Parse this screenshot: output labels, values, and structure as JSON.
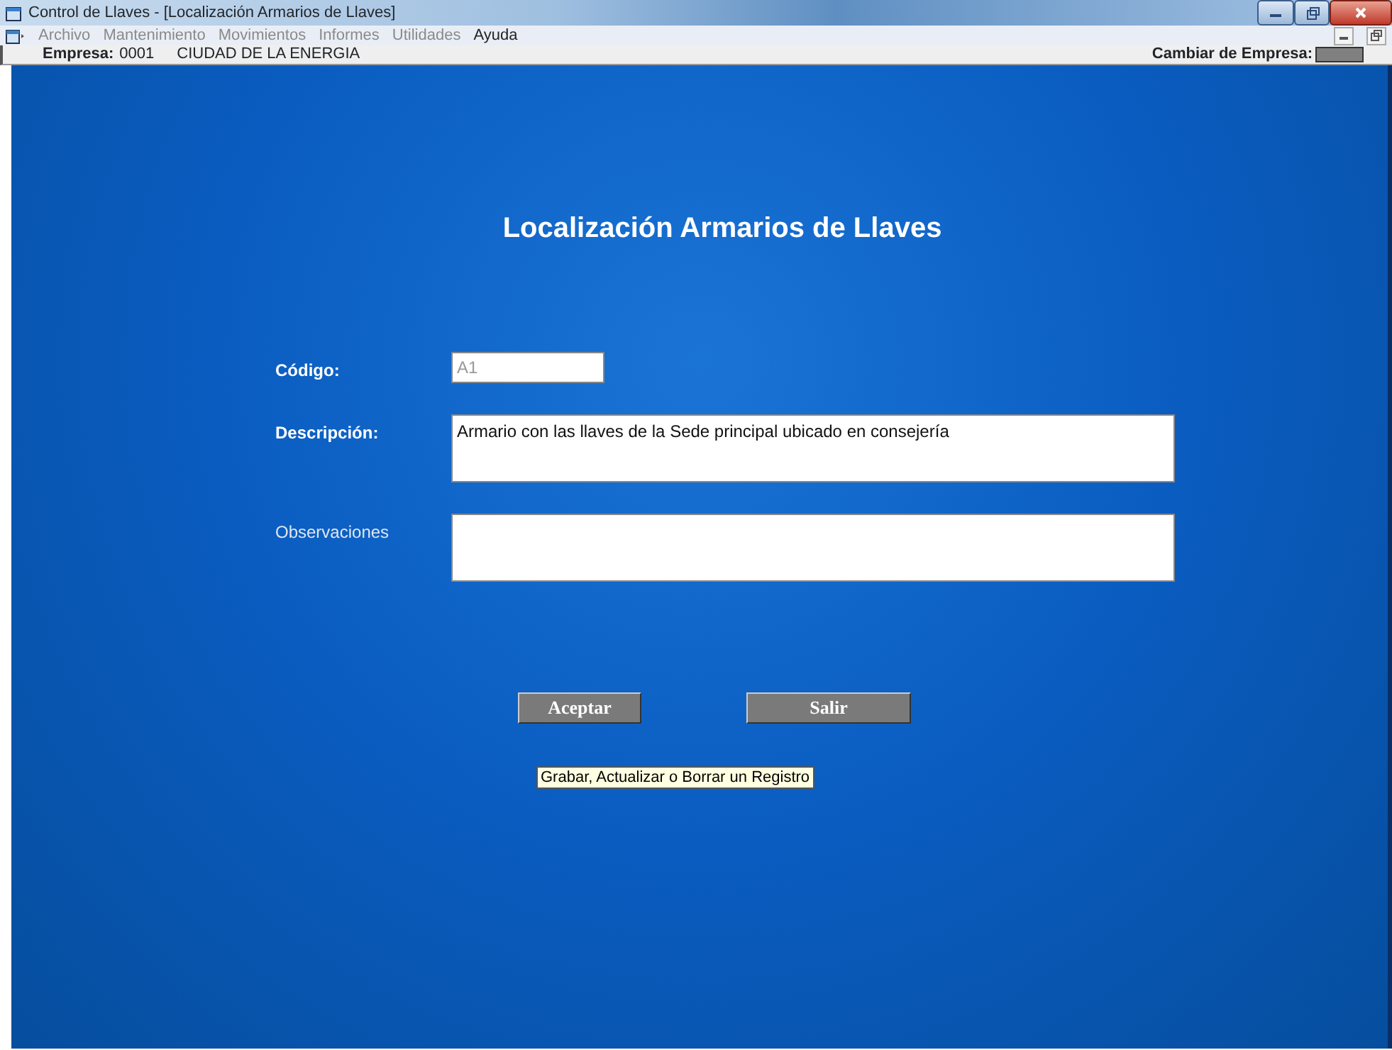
{
  "window": {
    "title": "Control de Llaves - [Localización Armarios de Llaves]"
  },
  "menu": [
    {
      "label": "Archivo",
      "disabled": true
    },
    {
      "label": "Mantenimiento",
      "disabled": true
    },
    {
      "label": "Movimientos",
      "disabled": true
    },
    {
      "label": "Informes",
      "disabled": true
    },
    {
      "label": "Utilidades",
      "disabled": true
    },
    {
      "label": "Ayuda",
      "disabled": false
    }
  ],
  "company_bar": {
    "label": "Empresa:",
    "code": "0001",
    "name": "CIUDAD DE LA ENERGIA",
    "change_label": "Cambiar de Empresa:"
  },
  "form": {
    "title": "Localización Armarios de Llaves",
    "fields": [
      {
        "kind": "input",
        "label": "Código:",
        "bold": true,
        "value": "A1",
        "disabled": true
      },
      {
        "kind": "textarea",
        "label": "Descripción:",
        "bold": true,
        "value": "Armario con las llaves de la Sede principal ubicado en consejería"
      },
      {
        "kind": "textarea",
        "label": "Observaciones",
        "bold": false
      }
    ],
    "buttons": [
      "Aceptar",
      "Salir"
    ],
    "tooltip": "Grabar, Actualizar o Borrar un Registro"
  }
}
